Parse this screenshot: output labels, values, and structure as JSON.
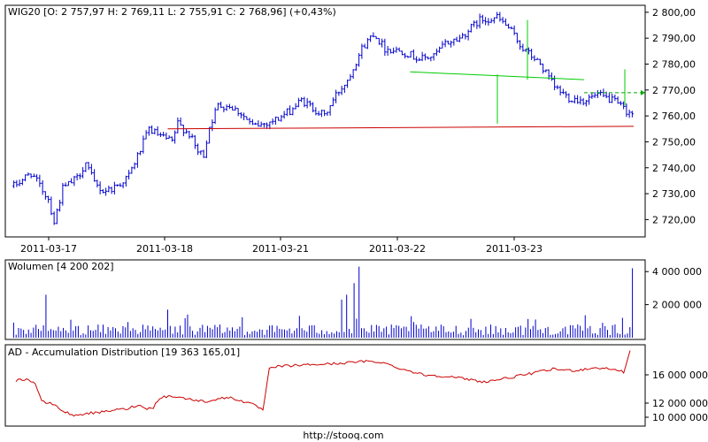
{
  "chart_data": [
    {
      "type": "candlestick",
      "title": "WIG20 [O: 2 757,97  H: 2 769,11  L: 2 755,91  C: 2 768,96] (+0,43%)",
      "ylim": [
        2714,
        2802
      ],
      "yticks": [
        {
          "v": 2720,
          "label": "2 720,00"
        },
        {
          "v": 2730,
          "label": "2 730,00"
        },
        {
          "v": 2740,
          "label": "2 740,00"
        },
        {
          "v": 2750,
          "label": "2 750,00"
        },
        {
          "v": 2760,
          "label": "2 760,00"
        },
        {
          "v": 2770,
          "label": "2 770,00"
        },
        {
          "v": 2780,
          "label": "2 780,00"
        },
        {
          "v": 2790,
          "label": "2 790,00"
        },
        {
          "v": 2800,
          "label": "2 800,00"
        }
      ],
      "x_dates": [
        "2011-03-17",
        "2011-03-18",
        "2011-03-21",
        "2011-03-22",
        "2011-03-23"
      ],
      "date_boundaries_index": [
        0,
        40,
        80,
        120,
        160
      ],
      "n_bars": 216,
      "price_path": [
        [
          0,
          2733
        ],
        [
          6,
          2738
        ],
        [
          12,
          2728
        ],
        [
          14,
          2719
        ],
        [
          17,
          2732
        ],
        [
          22,
          2736
        ],
        [
          25,
          2742
        ],
        [
          28,
          2734
        ],
        [
          31,
          2731
        ],
        [
          34,
          2732
        ],
        [
          37,
          2734
        ],
        [
          40,
          2737
        ],
        [
          44,
          2747
        ],
        [
          47,
          2755
        ],
        [
          51,
          2752
        ],
        [
          55,
          2750
        ],
        [
          57,
          2757
        ],
        [
          61,
          2753
        ],
        [
          64,
          2746
        ],
        [
          66,
          2745
        ],
        [
          68,
          2756
        ],
        [
          71,
          2764
        ],
        [
          75,
          2764
        ],
        [
          79,
          2761
        ],
        [
          83,
          2756
        ],
        [
          87,
          2757
        ],
        [
          92,
          2759
        ],
        [
          96,
          2762
        ],
        [
          100,
          2766
        ],
        [
          104,
          2763
        ],
        [
          108,
          2760
        ],
        [
          112,
          2768
        ],
        [
          116,
          2774
        ],
        [
          121,
          2786
        ],
        [
          125,
          2792
        ],
        [
          129,
          2786
        ],
        [
          135,
          2785
        ],
        [
          141,
          2782
        ],
        [
          146,
          2783
        ],
        [
          150,
          2788
        ],
        [
          155,
          2790
        ],
        [
          162,
          2797
        ],
        [
          168,
          2798
        ],
        [
          172,
          2794
        ],
        [
          177,
          2786
        ],
        [
          183,
          2780
        ],
        [
          188,
          2771
        ],
        [
          193,
          2767
        ],
        [
          198,
          2766
        ],
        [
          203,
          2768
        ],
        [
          208,
          2766
        ],
        [
          213,
          2762
        ],
        [
          216,
          2760
        ]
      ],
      "overlay_lines": [
        {
          "name": "support",
          "color": "#cc0000",
          "x0_frac": 0.25,
          "x1_frac": 1.0,
          "y0": 2755,
          "y1": 2756
        },
        {
          "name": "trend",
          "color": "#00cc00",
          "x0_frac": 0.64,
          "x1_frac": 0.92,
          "y0": 2777,
          "y1": 2774
        }
      ],
      "last_price": 2768.96
    },
    {
      "type": "bar",
      "title": "Wolumen [4 200 202]",
      "ylim": [
        0,
        4600000
      ],
      "yticks": [
        {
          "v": 2000000,
          "label": "2 000 000"
        },
        {
          "v": 4000000,
          "label": "4 000 000"
        }
      ],
      "last_value": 4200202
    },
    {
      "type": "line",
      "title": "AD - Accumulation Distribution [19 363 165,01]",
      "ylim": [
        9000000,
        19500000
      ],
      "yticks": [
        {
          "v": 10000000,
          "label": "10 000 000"
        },
        {
          "v": 12000000,
          "label": "12 000 000"
        },
        {
          "v": 16000000,
          "label": "16 000 000"
        }
      ],
      "path": [
        [
          0,
          15200000
        ],
        [
          5,
          15400000
        ],
        [
          9,
          14800000
        ],
        [
          12,
          12200000
        ],
        [
          18,
          11800000
        ],
        [
          22,
          10800000
        ],
        [
          28,
          10200000
        ],
        [
          33,
          10600000
        ],
        [
          38,
          10600000
        ],
        [
          45,
          11000000
        ],
        [
          52,
          11200000
        ],
        [
          57,
          11800000
        ],
        [
          60,
          11200000
        ],
        [
          64,
          11400000
        ],
        [
          67,
          12800000
        ],
        [
          72,
          13000000
        ],
        [
          80,
          12600000
        ],
        [
          88,
          12200000
        ],
        [
          94,
          12600000
        ],
        [
          100,
          12800000
        ],
        [
          106,
          12200000
        ],
        [
          112,
          11600000
        ],
        [
          115,
          11000000
        ],
        [
          118,
          16800000
        ],
        [
          122,
          17200000
        ],
        [
          135,
          17400000
        ],
        [
          150,
          17600000
        ],
        [
          162,
          17900000
        ],
        [
          170,
          17800000
        ],
        [
          180,
          16800000
        ],
        [
          190,
          16000000
        ],
        [
          200,
          15800000
        ],
        [
          210,
          15400000
        ],
        [
          218,
          15000000
        ],
        [
          230,
          15600000
        ],
        [
          240,
          16200000
        ],
        [
          250,
          16800000
        ],
        [
          260,
          16600000
        ],
        [
          270,
          17000000
        ],
        [
          278,
          16800000
        ],
        [
          283,
          16400000
        ],
        [
          286,
          19363165
        ]
      ],
      "last_value": 19363165.01
    }
  ],
  "footer": "http://stooq.com"
}
